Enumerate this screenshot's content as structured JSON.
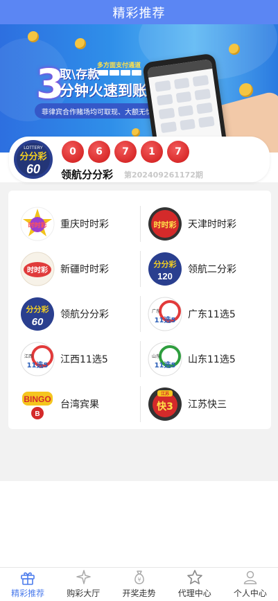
{
  "header": {
    "title": "精彩推荐"
  },
  "banner": {
    "big_number": "3",
    "line1": "取\\存款",
    "line2": "分钟火速到账",
    "pay_tag": "多方面支付通道",
    "note": "菲律宾合作赌场均可取现、大额无忧"
  },
  "latest_draw": {
    "numbers": [
      "0",
      "6",
      "7",
      "1",
      "7"
    ],
    "name": "领航分分彩",
    "period": "第202409261172期",
    "logo_text": "分分彩",
    "logo_sub": "60",
    "logo_tag": "LOTTERY"
  },
  "lotteries": [
    {
      "name": "重庆时时彩",
      "logo": "chongqing-ssc",
      "logo_text": "时时彩"
    },
    {
      "name": "天津时时彩",
      "logo": "tianjin-ssc",
      "logo_text": "时时彩"
    },
    {
      "name": "新疆时时彩",
      "logo": "xinjiang-ssc",
      "logo_text": "时时彩"
    },
    {
      "name": "领航二分彩",
      "logo": "fenfen-120",
      "logo_text": "分分彩",
      "logo_sub": "120"
    },
    {
      "name": "领航分分彩",
      "logo": "fenfen-60",
      "logo_text": "分分彩",
      "logo_sub": "60"
    },
    {
      "name": "广东11选5",
      "logo": "gd-11x5",
      "logo_text": "11选5",
      "logo_top": "广东"
    },
    {
      "name": "江西11选5",
      "logo": "jx-11x5",
      "logo_text": "11选5",
      "logo_top": "江西"
    },
    {
      "name": "山东11选5",
      "logo": "sd-11x5",
      "logo_text": "11选5",
      "logo_top": "山东"
    },
    {
      "name": "台湾宾果",
      "logo": "bingo",
      "logo_text": "BINGO",
      "logo_sub": "B"
    },
    {
      "name": "江苏快三",
      "logo": "js-k3",
      "logo_text": "快3",
      "logo_top": "江苏"
    }
  ],
  "tabbar": {
    "items": [
      {
        "label": "精彩推荐",
        "icon": "gift-icon",
        "active": true
      },
      {
        "label": "购彩大厅",
        "icon": "star-sparkle-icon",
        "active": false
      },
      {
        "label": "开奖走势",
        "icon": "money-bag-icon",
        "active": false
      },
      {
        "label": "代理中心",
        "icon": "star-outline-icon",
        "active": false
      },
      {
        "label": "个人中心",
        "icon": "user-icon",
        "active": false
      }
    ]
  },
  "colors": {
    "header_bg": "#5b86f3",
    "ball": "#d92b2b",
    "active_tab": "#4b7bec"
  }
}
